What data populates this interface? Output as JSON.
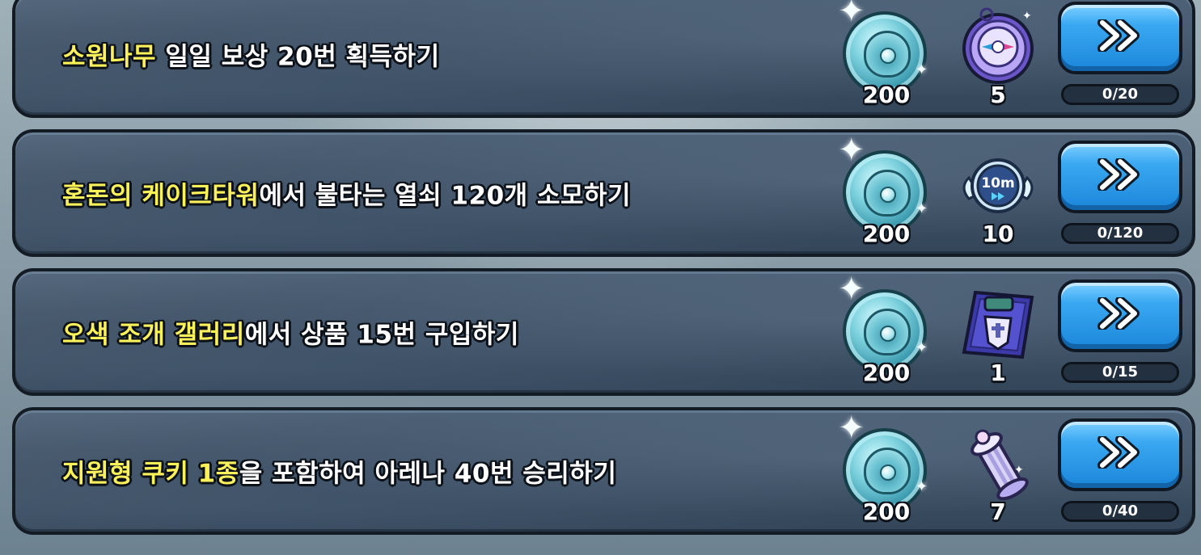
{
  "missions": [
    {
      "highlight": "소원나무",
      "text": " 일일 보상 20번 획득하기",
      "coin_amount": "200",
      "item_name": "compass-badge-icon",
      "item_amount": "5",
      "progress": "0/20"
    },
    {
      "highlight": "혼돈의 케이크타워",
      "text": "에서 불타는 열쇠 120개 소모하기",
      "coin_amount": "200",
      "item_name": "speedup-10m-icon",
      "item_timer_label": "10m",
      "item_amount": "10",
      "progress": "0/120"
    },
    {
      "highlight": "오색 조개 갤러리",
      "text": "에서 상품 15번 구입하기",
      "coin_amount": "200",
      "item_name": "treasure-chest-card-icon",
      "item_amount": "1",
      "progress": "0/15"
    },
    {
      "highlight": "지원형 쿠키 1종",
      "text": "을 포함하여 아레나 40번 승리하기",
      "coin_amount": "200",
      "item_name": "crystal-pillar-icon",
      "item_amount": "7",
      "progress": "0/40"
    }
  ],
  "colors": {
    "highlight": "#fbf15a",
    "text": "#ffffff",
    "button": "#3aa8f2",
    "row_bg": "#3d4f63"
  }
}
